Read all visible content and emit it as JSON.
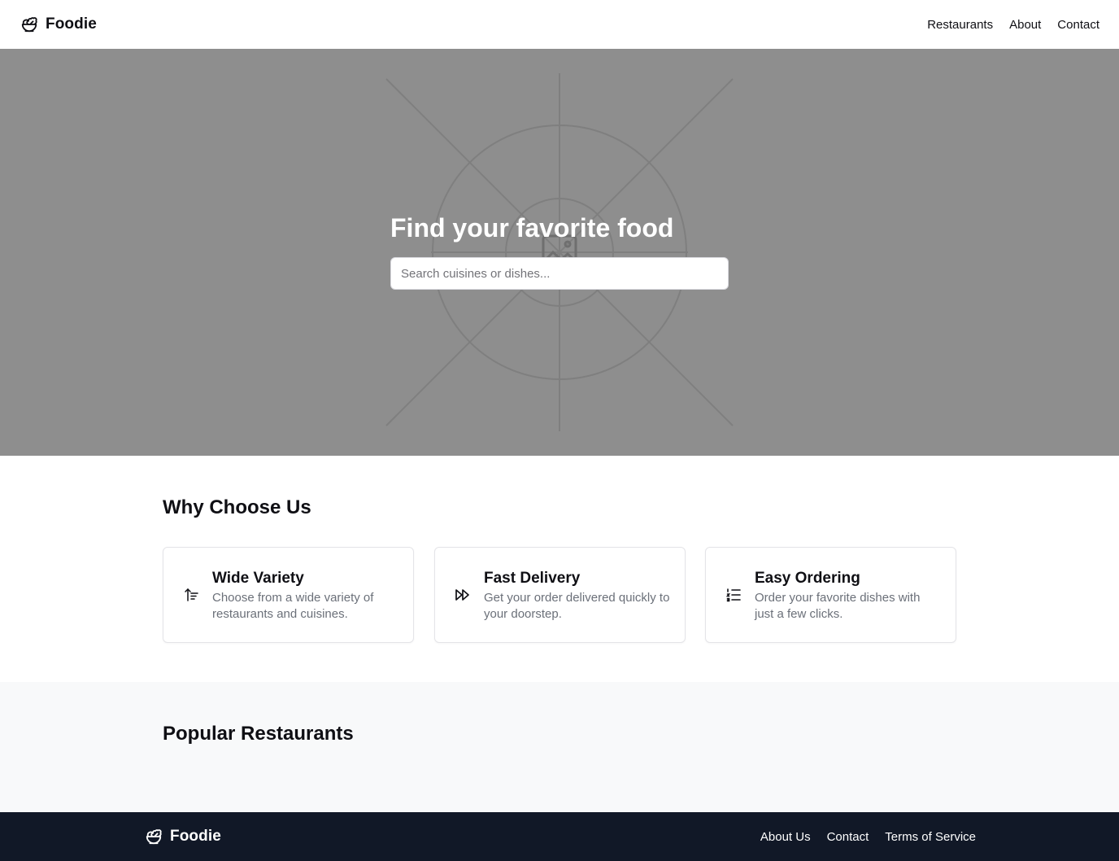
{
  "header": {
    "brand": {
      "name": "Foodie",
      "icon": "salad-bowl-icon"
    },
    "nav": [
      {
        "label": "Restaurants"
      },
      {
        "label": "About"
      },
      {
        "label": "Contact"
      }
    ]
  },
  "hero": {
    "title": "Find your favorite food",
    "search_placeholder": "Search cuisines or dishes...",
    "search_value": "",
    "background_color": "#8e8e8e",
    "image_icon": "image-placeholder-icon"
  },
  "features": {
    "title": "Why Choose Us",
    "items": [
      {
        "icon": "sort-ascending-icon",
        "title": "Wide Variety",
        "text": "Choose from a wide variety of restaurants and cuisines."
      },
      {
        "icon": "fast-forward-icon",
        "title": "Fast Delivery",
        "text": "Get your order delivered quickly to your doorstep."
      },
      {
        "icon": "list-ordered-icon",
        "title": "Easy Ordering",
        "text": "Order your favorite dishes with just a few clicks."
      }
    ]
  },
  "popular": {
    "title": "Popular Restaurants"
  },
  "footer": {
    "brand": {
      "name": "Foodie",
      "icon": "salad-bowl-icon"
    },
    "links": [
      {
        "label": "About Us"
      },
      {
        "label": "Contact"
      },
      {
        "label": "Terms of Service"
      }
    ],
    "background_color": "#111827"
  }
}
